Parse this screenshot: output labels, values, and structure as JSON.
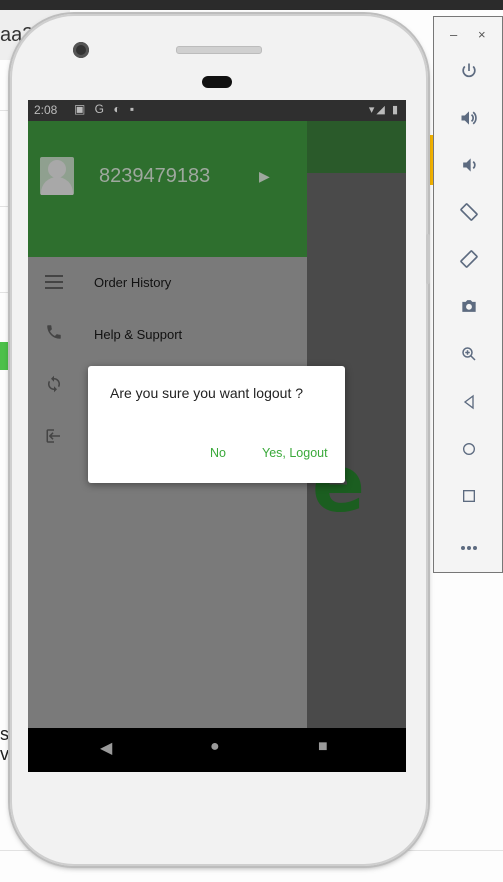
{
  "background": {
    "tab_text": "aa3",
    "left_letters": [
      "s",
      "v"
    ]
  },
  "device": {
    "status_bar": {
      "time": "2:08",
      "left_icons": "▣ G ◐ ▪",
      "right_icons": "▾◢ ▮"
    },
    "drawer": {
      "user_phone": "8239479183",
      "items": [
        {
          "icon": "menu-icon",
          "label": "Order History"
        },
        {
          "icon": "phone-icon",
          "label": "Help & Support"
        },
        {
          "icon": "sync-icon",
          "label": ""
        },
        {
          "icon": "logout-icon",
          "label": ""
        }
      ]
    },
    "app_logo_partial": "e",
    "dialog": {
      "message": "Are you sure you want logout ?",
      "no_label": "No",
      "yes_label": "Yes, Logout",
      "accent_color": "#3aa93a"
    },
    "nav_bar": {
      "back": "◀",
      "home": "●",
      "recents": "■"
    }
  },
  "emulator_toolbar": {
    "minimize": "–",
    "close": "×",
    "buttons": [
      {
        "name": "power-icon",
        "glyph": "⏻"
      },
      {
        "name": "volume-up-icon",
        "glyph": "🔊"
      },
      {
        "name": "volume-down-icon",
        "glyph": "🔉"
      },
      {
        "name": "rotate-left-icon",
        "glyph": "⟲"
      },
      {
        "name": "rotate-right-icon",
        "glyph": "⟳"
      },
      {
        "name": "camera-icon",
        "glyph": "📷"
      },
      {
        "name": "zoom-icon",
        "glyph": "🔍"
      },
      {
        "name": "back-icon",
        "glyph": "◁"
      },
      {
        "name": "home-icon",
        "glyph": "○"
      },
      {
        "name": "overview-icon",
        "glyph": "□"
      },
      {
        "name": "more-icon",
        "glyph": "•••"
      }
    ]
  }
}
